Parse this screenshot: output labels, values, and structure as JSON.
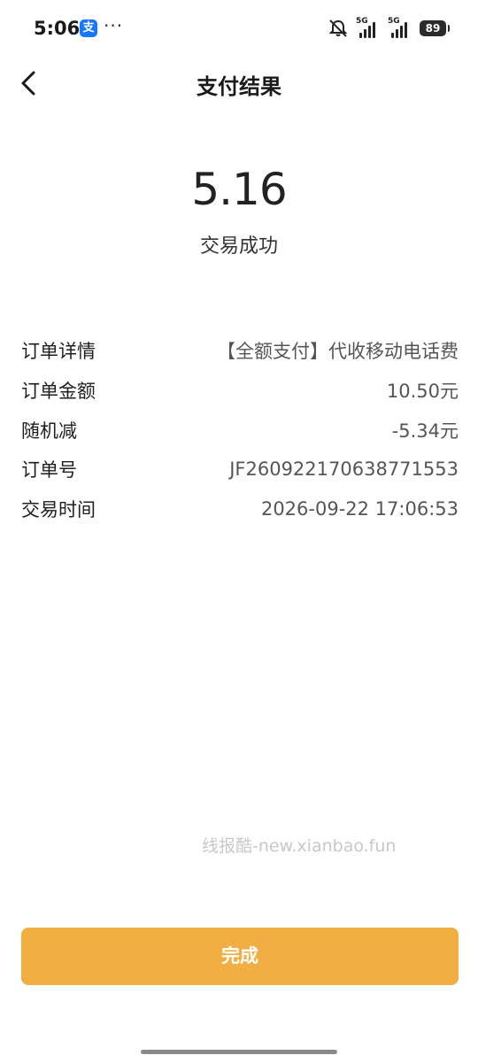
{
  "status_bar": {
    "time": "5:06",
    "app_icon_glyph": "支",
    "more": "···",
    "network_1": "5G",
    "network_2": "5G",
    "battery": "89"
  },
  "nav": {
    "back_icon": "chevron-left-icon",
    "title": "支付结果"
  },
  "result": {
    "amount": "5.16",
    "status": "交易成功"
  },
  "details": [
    {
      "label": "订单详情",
      "value": "【全额支付】代收移动电话费"
    },
    {
      "label": "订单金额",
      "value": "10.50元"
    },
    {
      "label": "随机减",
      "value": "-5.34元"
    },
    {
      "label": "订单号",
      "value": "JF2609221706387​71553"
    },
    {
      "label": "交易时间",
      "value": "2026-09-22 17:06:53"
    }
  ],
  "watermark": "线报酷-new.xianbao.fun",
  "done_button": "完成",
  "colors": {
    "accent": "#f2ae42",
    "alipay_blue": "#1677ff"
  }
}
